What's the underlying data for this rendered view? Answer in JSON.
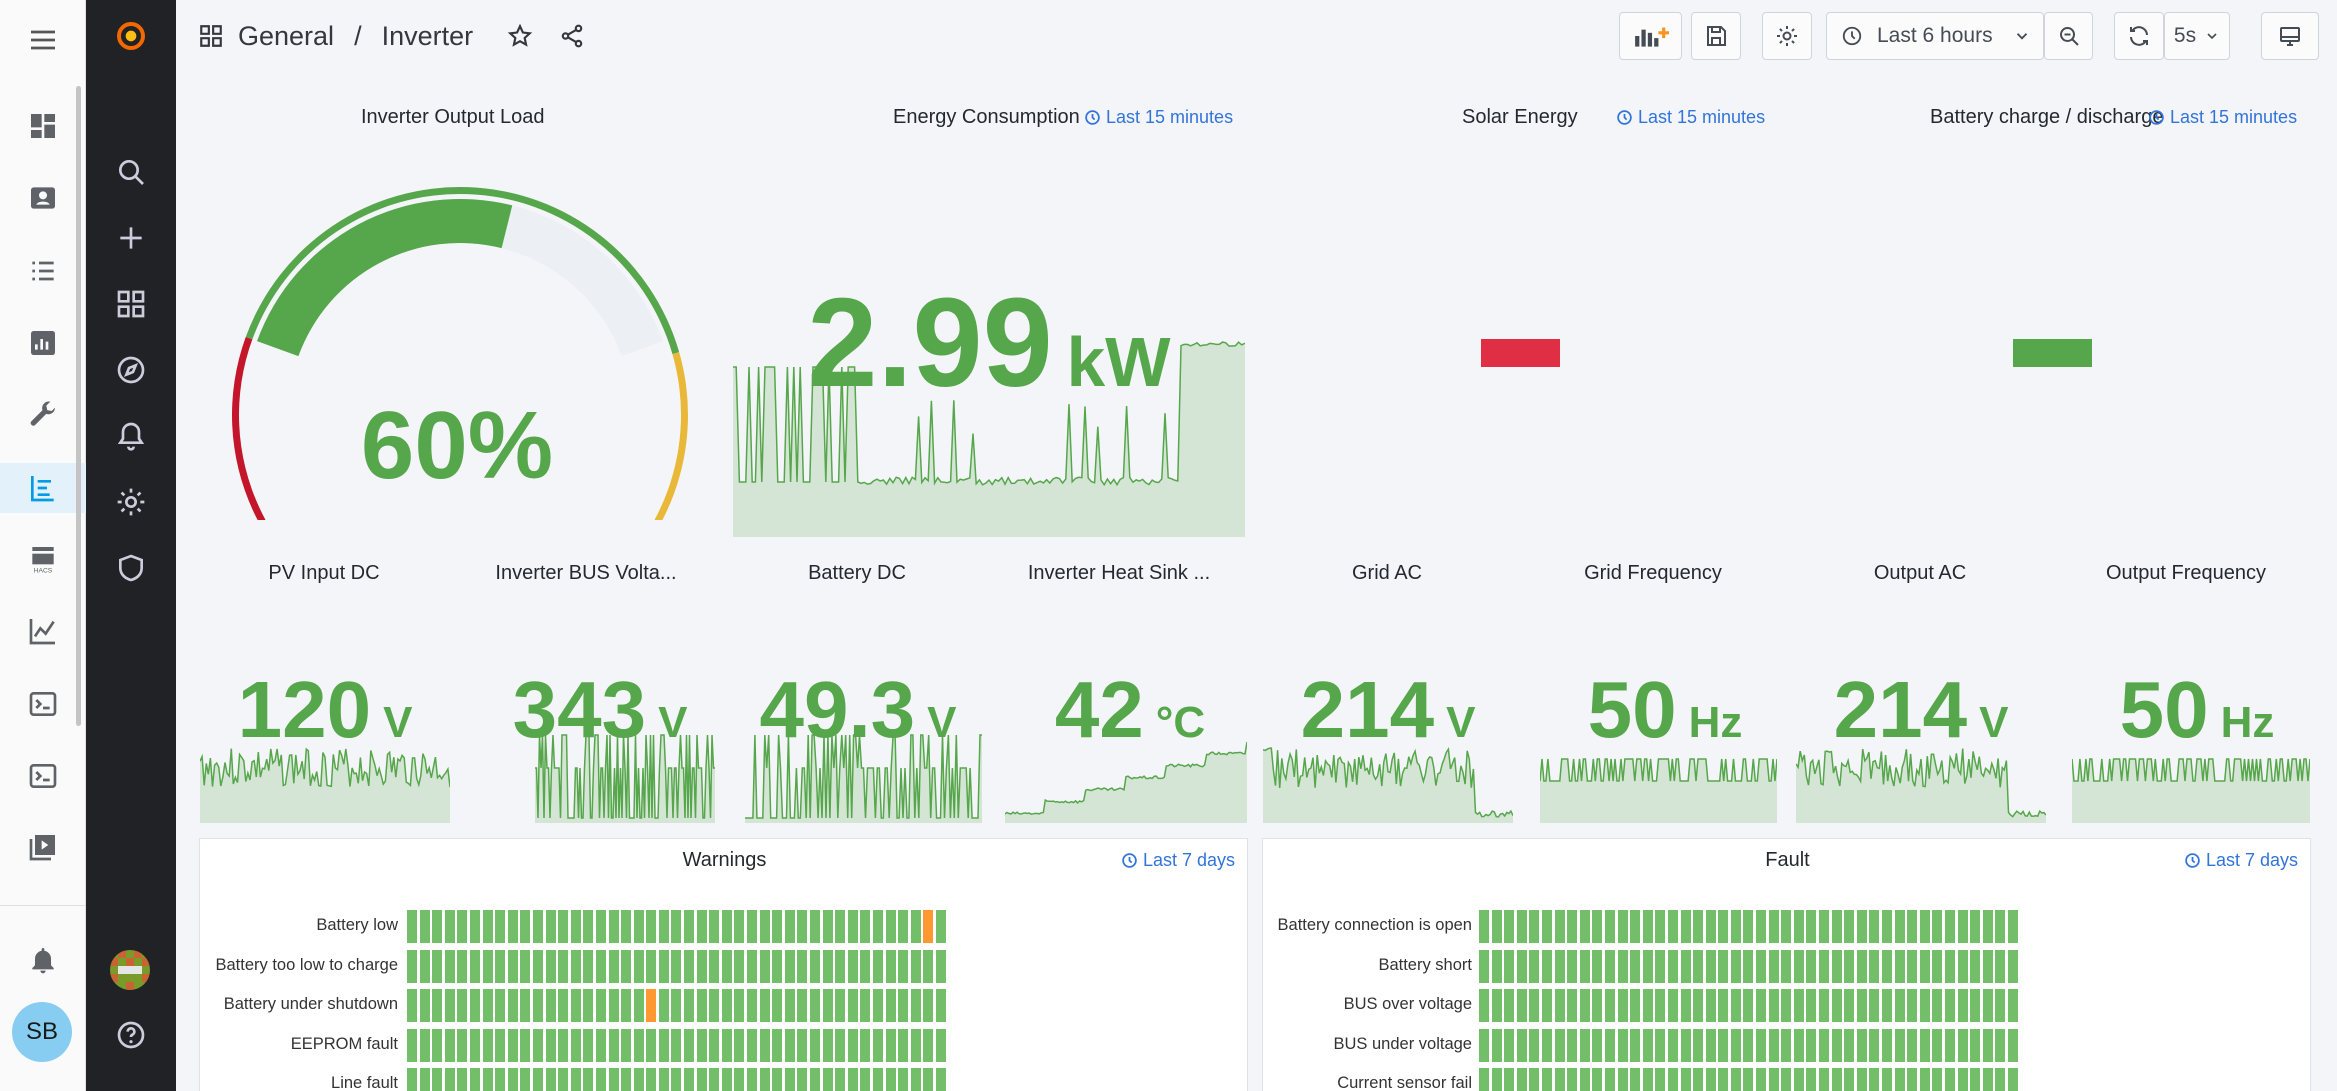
{
  "home_assistant_sidebar": {
    "menu_icon": "menu-icon",
    "items": [
      {
        "icon": "overview-icon"
      },
      {
        "icon": "person-badge-icon"
      },
      {
        "icon": "logbook-icon"
      },
      {
        "icon": "history-icon"
      },
      {
        "icon": "wrench-icon"
      },
      {
        "icon": "grafana-panel-icon",
        "active": true
      },
      {
        "icon": "hacs-icon",
        "label": "HACS"
      },
      {
        "icon": "chart-line-icon"
      },
      {
        "icon": "terminal-icon"
      },
      {
        "icon": "terminal-box-icon"
      },
      {
        "icon": "media-icon"
      }
    ],
    "notifications_icon": "bell-icon",
    "user_initials": "SB"
  },
  "grafana_sidebar": {
    "items": [
      "grafana-logo-icon",
      "search-icon",
      "plus-icon",
      "dashboards-icon",
      "explore-icon",
      "alerting-icon",
      "gear-icon",
      "shield-icon"
    ],
    "help_icon": "help-icon"
  },
  "topnav": {
    "folder": "General",
    "separator": "/",
    "dashboard": "Inverter",
    "time_range": "Last 6 hours",
    "refresh_interval": "5s"
  },
  "panels": {
    "output_load": {
      "title": "Inverter Output Load",
      "value": "60%",
      "percent": 60
    },
    "energy": {
      "title": "Energy Consumption",
      "time": "Last 15 minutes",
      "value": "2.99",
      "unit": "kW"
    },
    "solar": {
      "title": "Solar Energy",
      "time": "Last 15 minutes",
      "color": "#e02f44"
    },
    "battery_charge": {
      "title": "Battery charge / discharge",
      "time": "Last 15 minutes",
      "color": "#56a64b"
    }
  },
  "stats": [
    {
      "title": "PV Input DC",
      "value": "120",
      "unit": "V"
    },
    {
      "title": "Inverter BUS Volta...",
      "value": "343",
      "unit": "V"
    },
    {
      "title": "Battery DC",
      "value": "49.3",
      "unit": "V"
    },
    {
      "title": "Inverter Heat Sink ...",
      "value": "42",
      "unit": "°C"
    },
    {
      "title": "Grid AC",
      "value": "214",
      "unit": "V"
    },
    {
      "title": "Grid Frequency",
      "value": "50",
      "unit": "Hz"
    },
    {
      "title": "Output AC",
      "value": "214",
      "unit": "V"
    },
    {
      "title": "Output Frequency",
      "value": "50",
      "unit": "Hz"
    }
  ],
  "warnings": {
    "title": "Warnings",
    "time": "Last 7 days",
    "rows": [
      "Battery low",
      "Battery too low to charge",
      "Battery under shutdown",
      "EEPROM fault",
      "Line fault"
    ],
    "alerts": [
      [
        0,
        41
      ],
      [
        2,
        19
      ]
    ]
  },
  "fault": {
    "title": "Fault",
    "time": "Last 7 days",
    "rows": [
      "Battery connection is open",
      "Battery short",
      "BUS over voltage",
      "BUS under voltage",
      "Current sensor fail"
    ]
  },
  "colors": {
    "ok": "#73bf69",
    "warn": "#ff9830",
    "value": "#56a64b",
    "link": "#3274d9"
  }
}
